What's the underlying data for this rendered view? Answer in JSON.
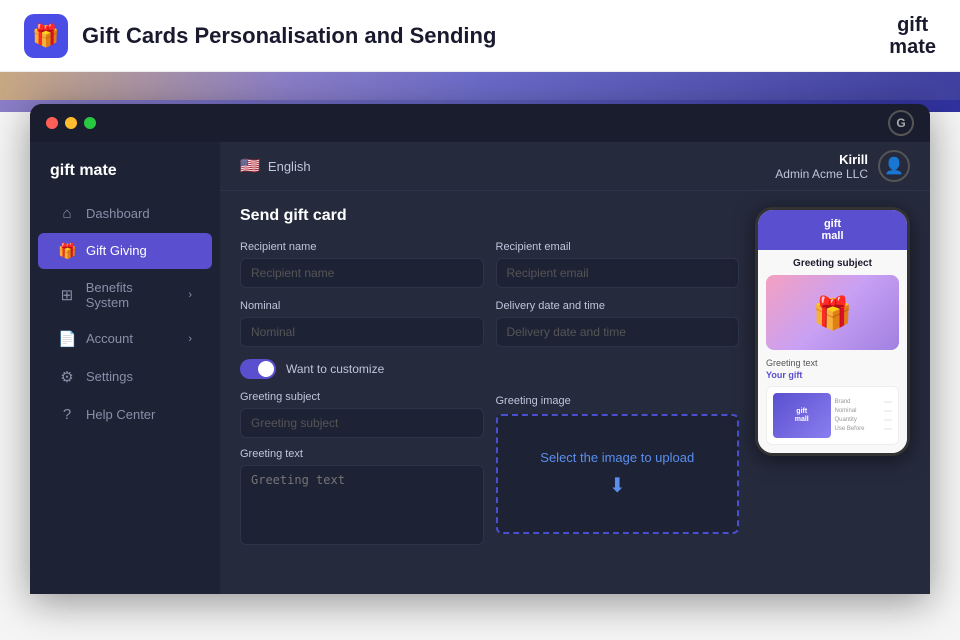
{
  "header": {
    "icon": "🎁",
    "title": "Gift Cards Personalisation and Sending",
    "logo_line1": "gift",
    "logo_line2": "mate"
  },
  "window": {
    "g_icon": "G"
  },
  "sidebar": {
    "logo_line1": "gift",
    "logo_line2": "mate",
    "items": [
      {
        "id": "dashboard",
        "label": "Dashboard",
        "icon": "⌂",
        "active": false
      },
      {
        "id": "gift-giving",
        "label": "Gift Giving",
        "icon": "🎁",
        "active": true
      },
      {
        "id": "benefits-system",
        "label": "Benefits System",
        "icon": "⊞",
        "active": false,
        "arrow": "›"
      },
      {
        "id": "account",
        "label": "Account",
        "icon": "📄",
        "active": false,
        "arrow": "›"
      },
      {
        "id": "settings",
        "label": "Settings",
        "icon": "⚙",
        "active": false
      },
      {
        "id": "help-center",
        "label": "Help Center",
        "icon": "?",
        "active": false
      }
    ]
  },
  "topbar": {
    "language": "English",
    "flag": "🇺🇸",
    "user": {
      "name": "Kirill",
      "role": "Admin",
      "company": "Acme LLC"
    }
  },
  "form": {
    "title": "Send gift card",
    "fields": {
      "recipient_name": {
        "label": "Recipient name",
        "placeholder": "Recipient name"
      },
      "recipient_email": {
        "label": "Recipient email",
        "placeholder": "Recipient email"
      },
      "nominal": {
        "label": "Nominal",
        "placeholder": "Nominal"
      },
      "delivery_date": {
        "label": "Delivery date and time",
        "placeholder": "Delivery date and time"
      },
      "greeting_subject": {
        "label": "Greeting subject",
        "placeholder": "Greeting subject"
      },
      "greeting_text": {
        "label": "Greeting text",
        "placeholder": "Greeting text"
      }
    },
    "toggle_label": "Want to customize",
    "greeting_image_label": "Greeting image",
    "upload_text": "Select the image to upload",
    "upload_icon": "⬇"
  },
  "mobile_preview": {
    "logo_line1": "gift",
    "logo_line2": "mall",
    "greeting_subject": "Greeting subject",
    "greeting_text_label": "Greeting text",
    "your_gift": "Your gift",
    "card_logo_line1": "gift",
    "card_logo_line2": "mall",
    "info_rows": [
      {
        "label": "Brand",
        "value": ""
      },
      {
        "label": "Nominal",
        "value": ""
      },
      {
        "label": "Quantity",
        "value": ""
      },
      {
        "label": "Use Before",
        "value": ""
      }
    ]
  }
}
